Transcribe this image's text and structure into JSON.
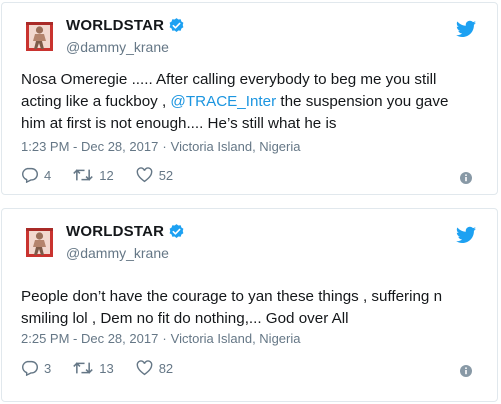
{
  "colors": {
    "link": "#1b95e0",
    "verified": "#1da1f2",
    "twitter_bird": "#1da1f2",
    "secondary_text": "#657786",
    "border": "#e1e8ed"
  },
  "tweets": [
    {
      "display_name": "WORLDSTAR",
      "handle": "@dammy_krane",
      "text_before": "Nosa Omeregie ..... After calling everybody to beg me you still acting like a fuckboy , ",
      "mention": "@TRACE_Inter",
      "text_after": " the suspension you gave him at first is not enough.... He’s still what he is",
      "time": "1:23 PM - Dec 28, 2017",
      "location": "Victoria Island, Nigeria",
      "replies": "4",
      "retweets": "12",
      "likes": "52"
    },
    {
      "display_name": "WORLDSTAR",
      "handle": "@dammy_krane",
      "text": "People don’t have the courage to yan these things , suffering n smiling lol , Dem no fit do nothing,... God over All",
      "time": "2:25 PM - Dec 28, 2017",
      "location": "Victoria Island, Nigeria",
      "replies": "3",
      "retweets": "13",
      "likes": "82"
    }
  ],
  "icons": [
    "avatar-photo",
    "verified-badge-icon",
    "twitter-bird-icon",
    "reply-icon",
    "retweet-icon",
    "like-icon",
    "info-icon"
  ]
}
